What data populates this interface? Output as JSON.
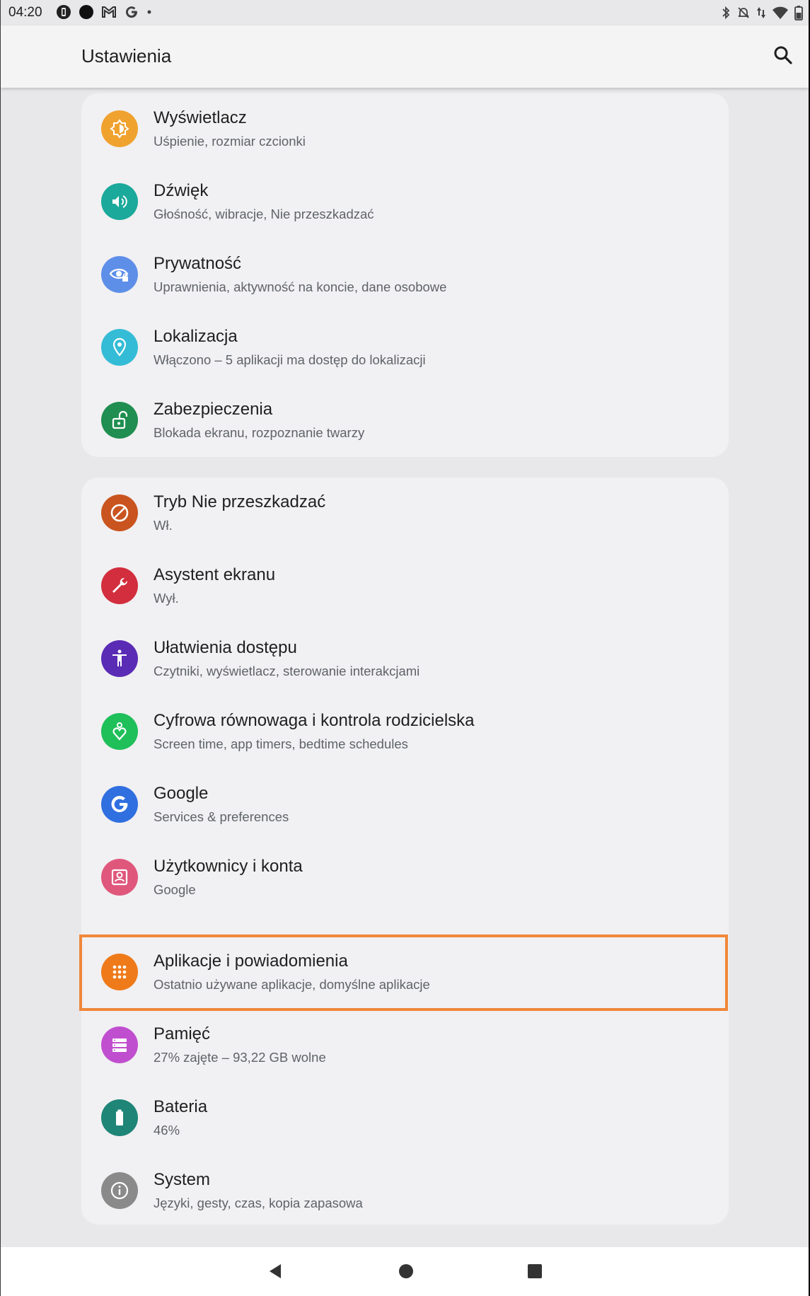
{
  "status_bar": {
    "time": "04:20",
    "left_icons": [
      "battery-saver-icon",
      "circle-icon",
      "gmail-icon",
      "google-icon",
      "dot-icon"
    ],
    "right_icons": [
      "bluetooth-icon",
      "do-not-disturb-bell-icon",
      "data-arrows-icon",
      "wifi-icon",
      "battery-icon"
    ]
  },
  "app_bar": {
    "title": "Ustawienia",
    "search_icon": "search-icon"
  },
  "groups": [
    {
      "items": [
        {
          "label": "Wyświetlacz",
          "sub": "Uśpienie, rozmiar czcionki",
          "icon": "brightness-icon",
          "color": "#f0a22e"
        },
        {
          "label": "Dźwięk",
          "sub": "Głośność, wibracje, Nie przeszkadzać",
          "icon": "volume-icon",
          "color": "#1aa99a"
        },
        {
          "label": "Prywatność",
          "sub": "Uprawnienia, aktywność na koncie, dane osobowe",
          "icon": "privacy-eye-icon",
          "color": "#5e8fe8"
        },
        {
          "label": "Lokalizacja",
          "sub": "Włączono – 5 aplikacji ma dostęp do lokalizacji",
          "icon": "location-pin-icon",
          "color": "#34bcd6"
        },
        {
          "label": "Zabezpieczenia",
          "sub": "Blokada ekranu, rozpoznanie twarzy",
          "icon": "unlock-icon",
          "color": "#1f8e50"
        }
      ]
    },
    {
      "items": [
        {
          "label": "Tryb Nie przeszkadzać",
          "sub": "Wł.",
          "icon": "do-not-disturb-icon",
          "color": "#c9541f"
        },
        {
          "label": "Asystent ekranu",
          "sub": "Wył.",
          "icon": "wrench-icon",
          "color": "#d22e3d"
        },
        {
          "label": "Ułatwienia dostępu",
          "sub": "Czytniki, wyświetlacz, sterowanie interakcjami",
          "icon": "accessibility-icon",
          "color": "#5a2bb5"
        },
        {
          "label": "Cyfrowa równowaga i kontrola rodzicielska",
          "sub": "Screen time, app timers, bedtime schedules",
          "icon": "wellbeing-heart-icon",
          "color": "#1fbf5a"
        },
        {
          "label": "Google",
          "sub": "Services & preferences",
          "icon": "google-g-icon",
          "color": "#2f6fe0"
        },
        {
          "label": "Użytkownicy i konta",
          "sub": "Google",
          "icon": "account-box-icon",
          "color": "#e0577c"
        },
        {
          "label": "Aplikacje i powiadomienia",
          "sub": "Ostatnio używane aplikacje, domyślne aplikacje",
          "icon": "apps-grid-icon",
          "color": "#ef7a1a",
          "highlighted": true
        },
        {
          "label": "Pamięć",
          "sub": "27% zajęte – 93,22 GB wolne",
          "icon": "storage-icon",
          "color": "#c04fcf"
        },
        {
          "label": "Bateria",
          "sub": "46%",
          "icon": "battery-full-icon",
          "color": "#1e8577"
        },
        {
          "label": "System",
          "sub": "Języki, gesty, czas, kopia zapasowa",
          "icon": "info-icon",
          "color": "#8a8a8a"
        }
      ]
    }
  ],
  "nav_bar": {
    "buttons": [
      "back-icon",
      "home-icon",
      "recents-icon"
    ]
  }
}
